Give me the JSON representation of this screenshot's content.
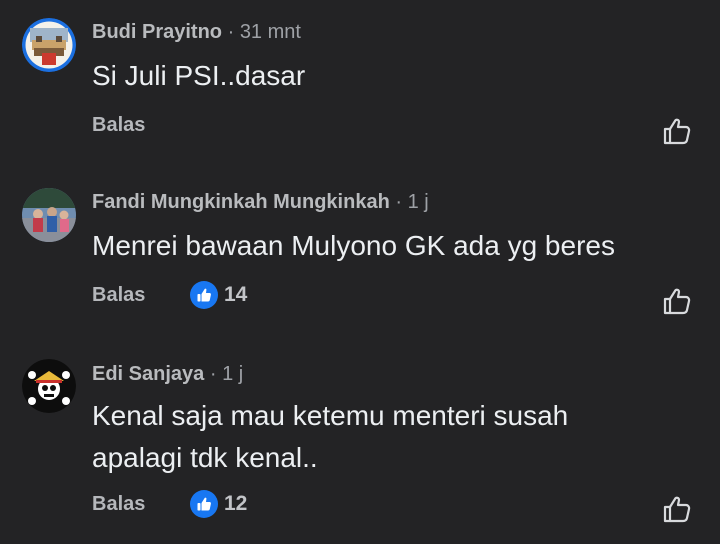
{
  "comments": [
    {
      "author": "Budi Prayitno",
      "separator": "·",
      "time": "31 mnt",
      "text": "Si Juli PSI..dasar",
      "reply_label": "Balas",
      "like_icon": "thumb-up-outline-icon"
    },
    {
      "author": "Fandi Mungkinkah Mungkinkah",
      "separator": "·",
      "time": "1 j",
      "text": "Menrei bawaan Mulyono GK ada yg beres",
      "reply_label": "Balas",
      "reaction_count": "14",
      "reaction_icon": "like-reaction-icon",
      "like_icon": "thumb-up-outline-icon"
    },
    {
      "author": "Edi Sanjaya",
      "separator": "·",
      "time": "1 j",
      "text": "Kenal saja mau ketemu menteri susah apalagi tdk kenal..",
      "reply_label": "Balas",
      "reaction_count": "12",
      "reaction_icon": "like-reaction-icon",
      "like_icon": "thumb-up-outline-icon"
    }
  ],
  "colors": {
    "background": "#232325",
    "text": "#eceff2",
    "meta": "#b9bbbe",
    "like_blue": "#1877f2",
    "avatar_ring": "#1b6fe0"
  }
}
